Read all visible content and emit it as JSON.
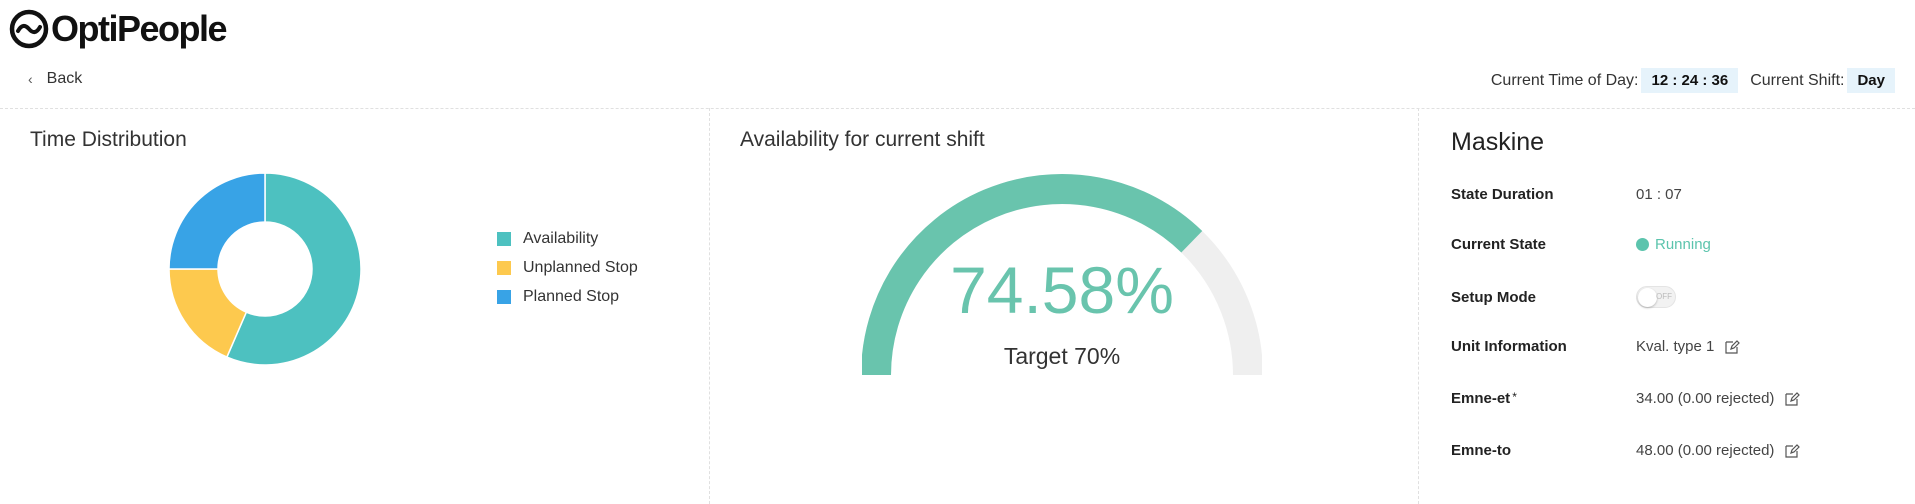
{
  "brand": {
    "name": "OptiPeople"
  },
  "nav": {
    "back_label": "Back"
  },
  "header": {
    "time_label": "Current Time of Day:",
    "time_value": "12 : 24 : 36",
    "shift_label": "Current Shift:",
    "shift_value": "Day"
  },
  "time_distribution": {
    "title": "Time Distribution",
    "legend": [
      {
        "label": "Availability",
        "color": "#4dc1c0"
      },
      {
        "label": "Unplanned Stop",
        "color": "#fdc94e"
      },
      {
        "label": "Planned Stop",
        "color": "#38a3e6"
      }
    ]
  },
  "availability": {
    "title": "Availability for current shift",
    "value": "74.58%",
    "target": "Target 70%",
    "fill_color": "#69c4ad",
    "track_color": "#efefef"
  },
  "chart_data": [
    {
      "type": "pie",
      "categories": [
        "Availability",
        "Unplanned Stop",
        "Planned Stop"
      ],
      "values": [
        56.5,
        18.5,
        25
      ],
      "colors": [
        "#4dc1c0",
        "#fdc94e",
        "#38a3e6"
      ],
      "title": "Time Distribution",
      "legend": "right"
    },
    {
      "type": "gauge",
      "value": 74.58,
      "max": 100,
      "title": "Availability for current shift"
    }
  ],
  "machine": {
    "title": "Maskine",
    "rows": {
      "state_duration": {
        "label": "State Duration",
        "value": "01 : 07"
      },
      "current_state": {
        "label": "Current State",
        "value": "Running"
      },
      "setup_mode": {
        "label": "Setup Mode",
        "toggle_text": "OFF"
      },
      "unit_information": {
        "label": "Unit Information",
        "value": "Kval. type 1"
      },
      "emne_et": {
        "label": "Emne-et",
        "required_mark": "*",
        "value": "34.00 (0.00 rejected)"
      },
      "emne_to": {
        "label": "Emne-to",
        "value": "48.00 (0.00 rejected)"
      }
    }
  }
}
